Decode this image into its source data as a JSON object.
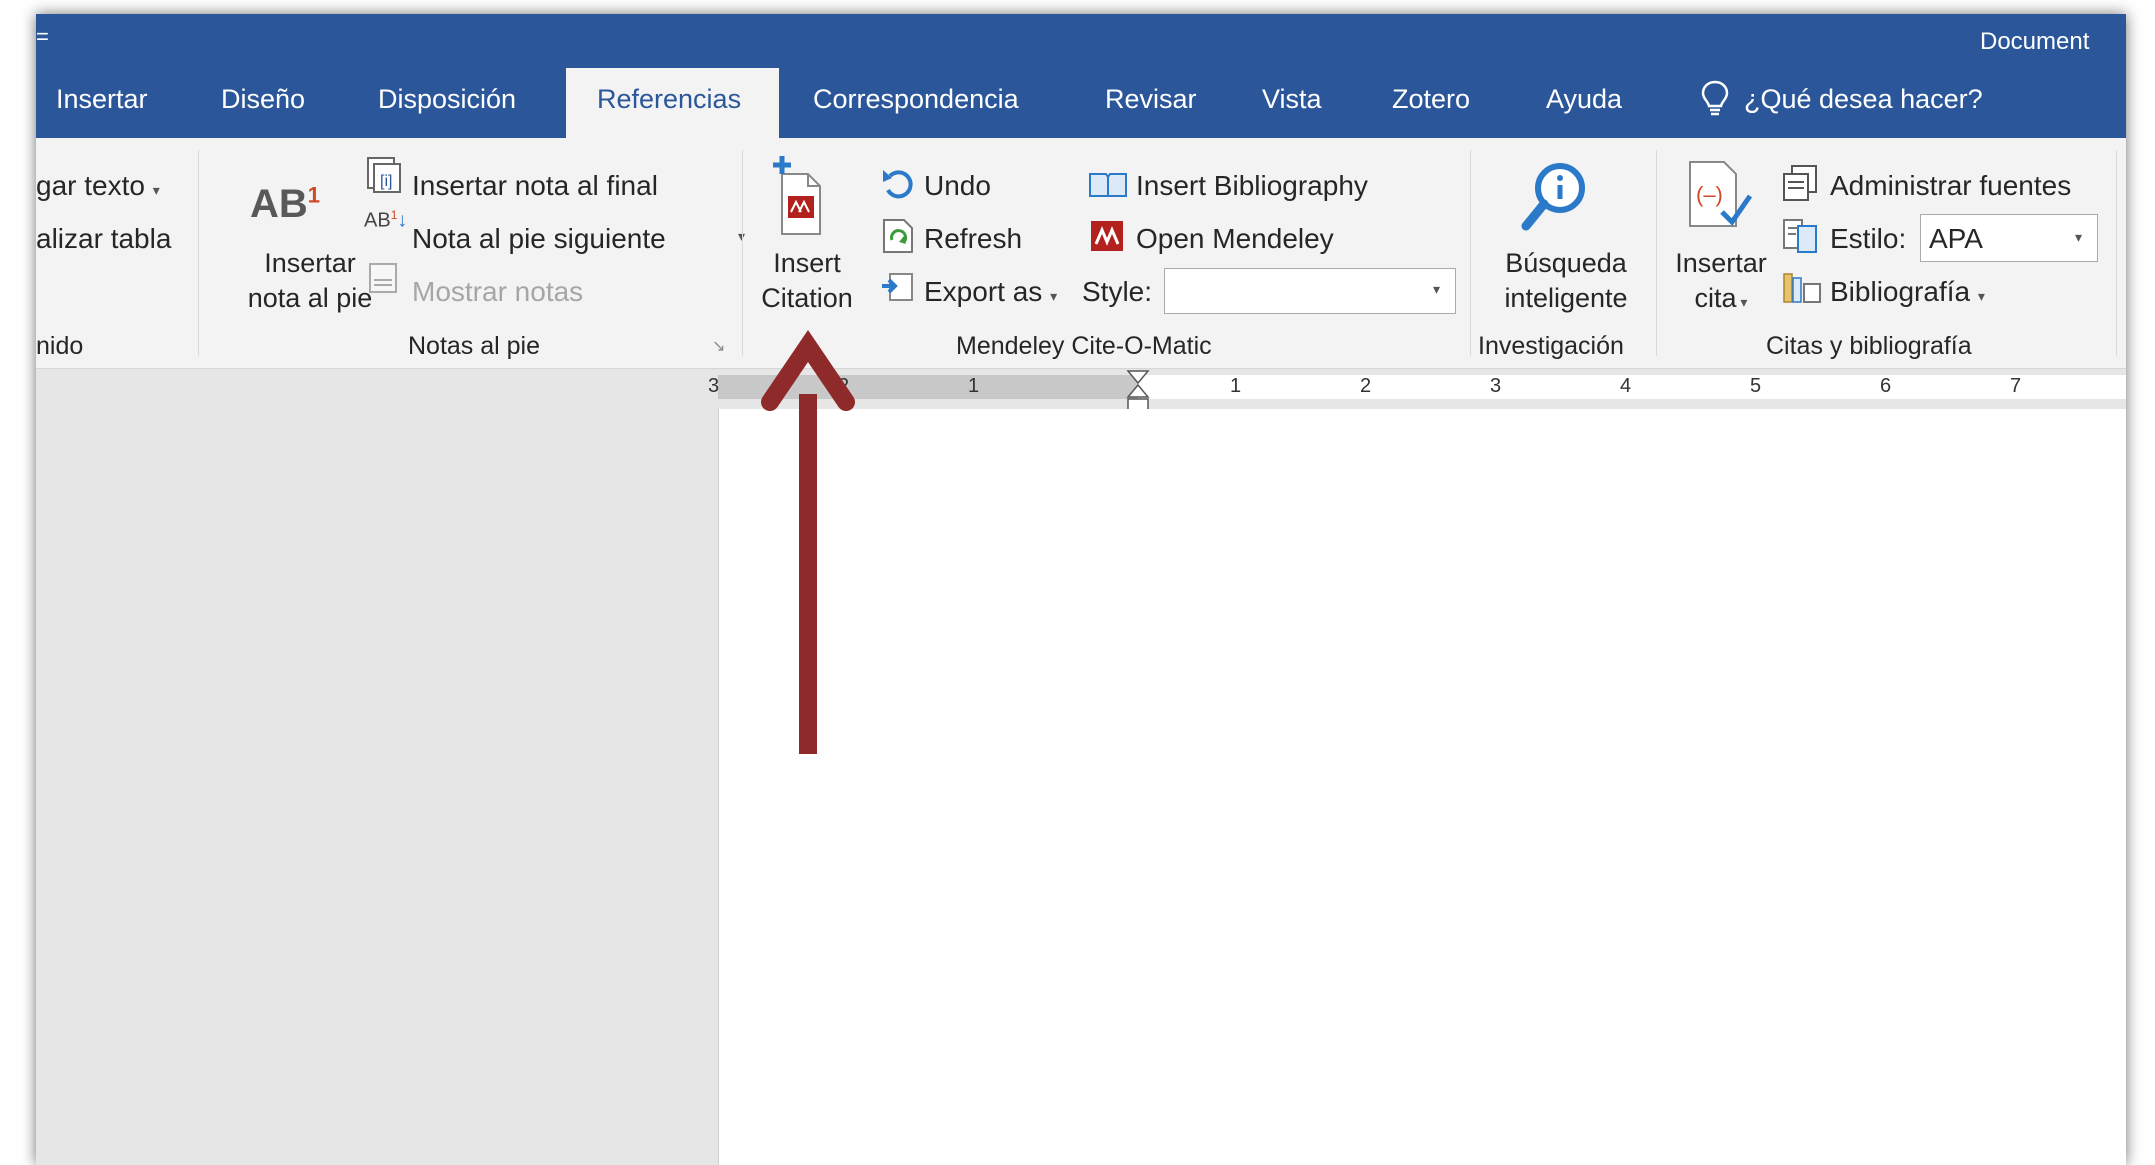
{
  "window": {
    "title": "Document"
  },
  "tabs": [
    {
      "label": "Insertar"
    },
    {
      "label": "Diseño"
    },
    {
      "label": "Disposición"
    },
    {
      "label": "Referencias"
    },
    {
      "label": "Correspondencia"
    },
    {
      "label": "Revisar"
    },
    {
      "label": "Vista"
    },
    {
      "label": "Zotero"
    },
    {
      "label": "Ayuda"
    }
  ],
  "active_tab": "Referencias",
  "tell_me": {
    "text": "¿Qué desea hacer?"
  },
  "ribbon": {
    "toc_group": {
      "add_text": "gar texto",
      "update_table": "alizar tabla",
      "label": "nido"
    },
    "footnotes_group": {
      "insert_footnote_big": "AB",
      "insert_footnote_sup": "1",
      "insert_footnote_line1": "Insertar",
      "insert_footnote_line2": "nota al pie",
      "insert_endnote": "Insertar nota al final",
      "next_footnote": "Nota al pie siguiente",
      "show_notes": "Mostrar notas",
      "label": "Notas al pie"
    },
    "mendeley_group": {
      "insert_citation_line1": "Insert",
      "insert_citation_line2": "Citation",
      "undo": "Undo",
      "refresh": "Refresh",
      "export_as": "Export as",
      "insert_bibliography": "Insert Bibliography",
      "open_mendeley": "Open Mendeley",
      "style_label": "Style:",
      "style_value": "",
      "label": "Mendeley Cite-O-Matic"
    },
    "research_group": {
      "smart_lookup_line1": "Búsqueda",
      "smart_lookup_line2": "inteligente",
      "label": "Investigación"
    },
    "citations_group": {
      "insert_citation_line1": "Insertar",
      "insert_citation_line2": "cita",
      "manage_sources": "Administrar fuentes",
      "style_label": "Estilo:",
      "style_value": "APA",
      "bibliography": "Bibliografía",
      "label": "Citas y bibliografía"
    }
  },
  "ruler": {
    "left_numbers": [
      "3",
      "2",
      "1"
    ],
    "right_numbers": [
      "1",
      "2",
      "3",
      "4",
      "5",
      "6",
      "7"
    ]
  },
  "colors": {
    "title_bar": "#2b579a",
    "ribbon": "#f3f3f3",
    "active_tab_text": "#2b579a",
    "arrow": "#9b2f2f",
    "mendeley_red": "#b3211e"
  }
}
